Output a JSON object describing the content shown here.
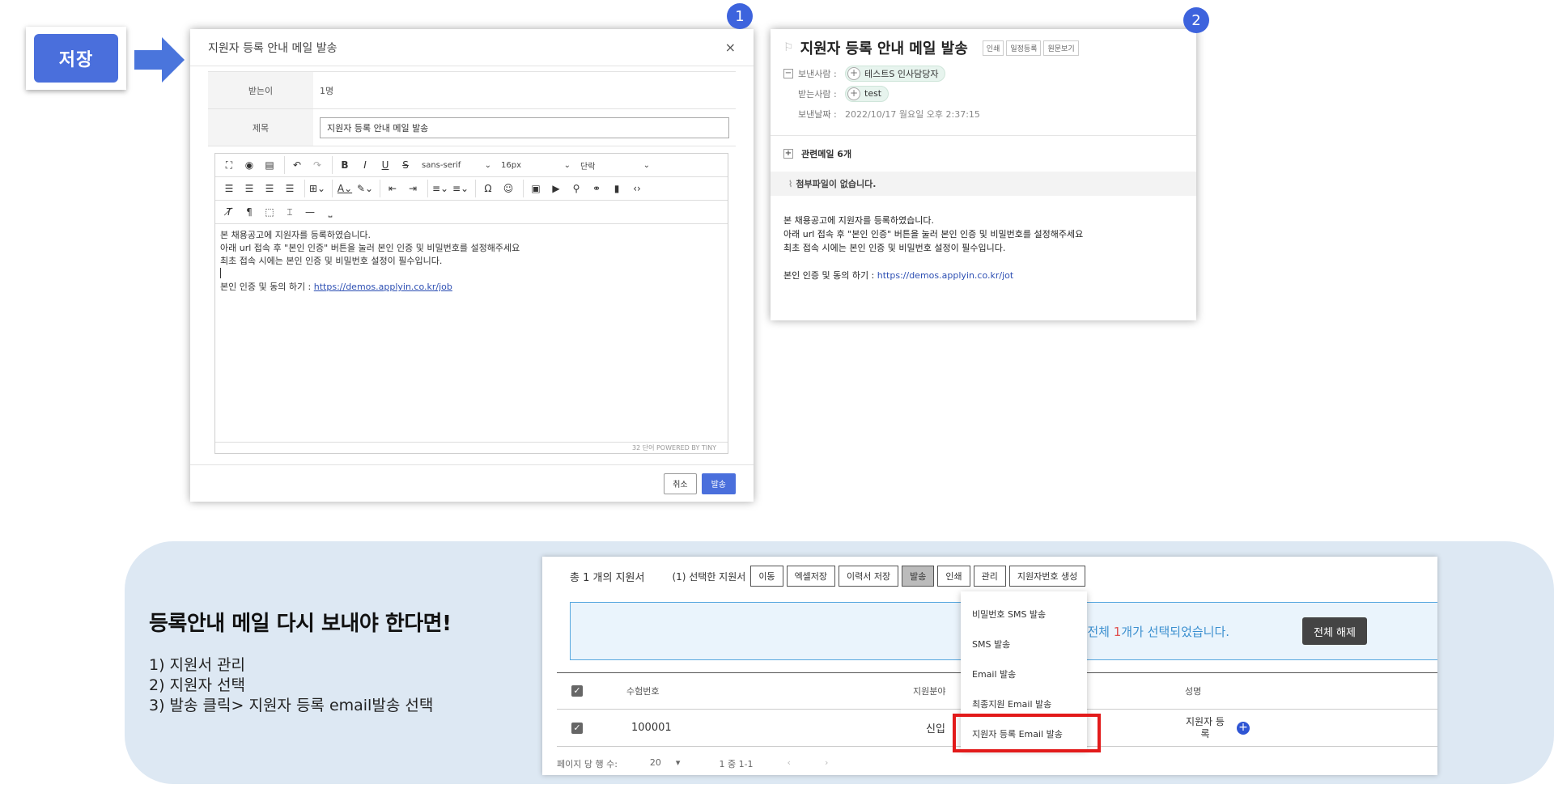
{
  "save_button": {
    "label": "저장"
  },
  "badges": {
    "one": "1",
    "two": "2"
  },
  "compose": {
    "title": "지원자 등록 안내 메일 발송",
    "close": "×",
    "recipient_label": "받는이",
    "recipient_value": "1명",
    "subject_label": "제목",
    "subject_value": "지원자 등록 안내 메일 발송",
    "toolbar": {
      "font": "sans-serif",
      "size": "16px",
      "block": "단락",
      "special_char": "Ω"
    },
    "body_lines": [
      "본 채용공고에 지원자를 등록하였습니다.",
      "아래 url 접속 후 \"본인 인증\" 버튼을 눌러 본인 인증 및 비밀번호를 설정해주세요",
      "최초 접속 시에는 본인 인증 및 비밀번호 설정이 필수입니다."
    ],
    "link_prefix": "본인 인증 및 동의 하기 : ",
    "link_text": "https://demos.applyin.co.kr/job",
    "status": "32 단어  POWERED BY TINY",
    "cancel": "취소",
    "send": "발송"
  },
  "mail": {
    "title": "지원자 등록 안내 메일 발송",
    "actions": [
      "인쇄",
      "일정등록",
      "원문보기"
    ],
    "sender_label": "보낸사람 :",
    "sender": "테스트S 인사담당자",
    "receiver_label": "받는사람 :",
    "receiver": "test",
    "date_label": "보낸날짜 :",
    "date": "2022/10/17 월요일 오후 2:37:15",
    "related": "관련메일  6개",
    "attachment": "첨부파일이 없습니다.",
    "body_lines": [
      "본 채용공고에 지원자를 등록하였습니다.",
      "아래 url 접속 후 \"본인 인증\" 버튼을 눌러 본인 인증 및 비밀번호를 설정해주세요",
      "최초 접속 시에는 본인 인증 및 비밀번호 설정이 필수입니다."
    ],
    "link_prefix": "본인 인증 및 동의 하기 : ",
    "link_text": "https://demos.applyin.co.kr/jot"
  },
  "guide": {
    "title": "등록안내 메일 다시 보내야 한다면!",
    "steps": [
      "1) 지원서 관리",
      "2) 지원자 선택",
      "3) 발송 클릭> 지원자 등록 email발송 선택"
    ]
  },
  "list": {
    "total": "총 1 개의 지원서",
    "selected": "(1) 선택한 지원서",
    "actions": [
      "이동",
      "엑셀저장",
      "이력서 저장",
      "발송",
      "인쇄",
      "관리",
      "지원자번호 생성"
    ],
    "notice_prefix": "원서 전체 ",
    "notice_count": "1",
    "notice_suffix": "개가 선택되었습니다.",
    "clear": "전체 해제",
    "headers": {
      "number": "수험번호",
      "field": "지원분야",
      "name": "성명"
    },
    "row": {
      "number": "100001",
      "field": "신입",
      "name": "지원자 등록"
    },
    "pager": {
      "label": "페이지 당 행 수:",
      "rows": "20",
      "range": "1 중 1-1"
    }
  },
  "dropdown": [
    "비밀번호 SMS 발송",
    "SMS 발송",
    "Email 발송",
    "최종지원 Email 발송",
    "지원자 등록 Email 발송"
  ],
  "colors": {
    "accent": "#4a6fdc",
    "badge": "#3d63dd",
    "highlight": "#e21a1a",
    "panel": "#dde8f3"
  }
}
